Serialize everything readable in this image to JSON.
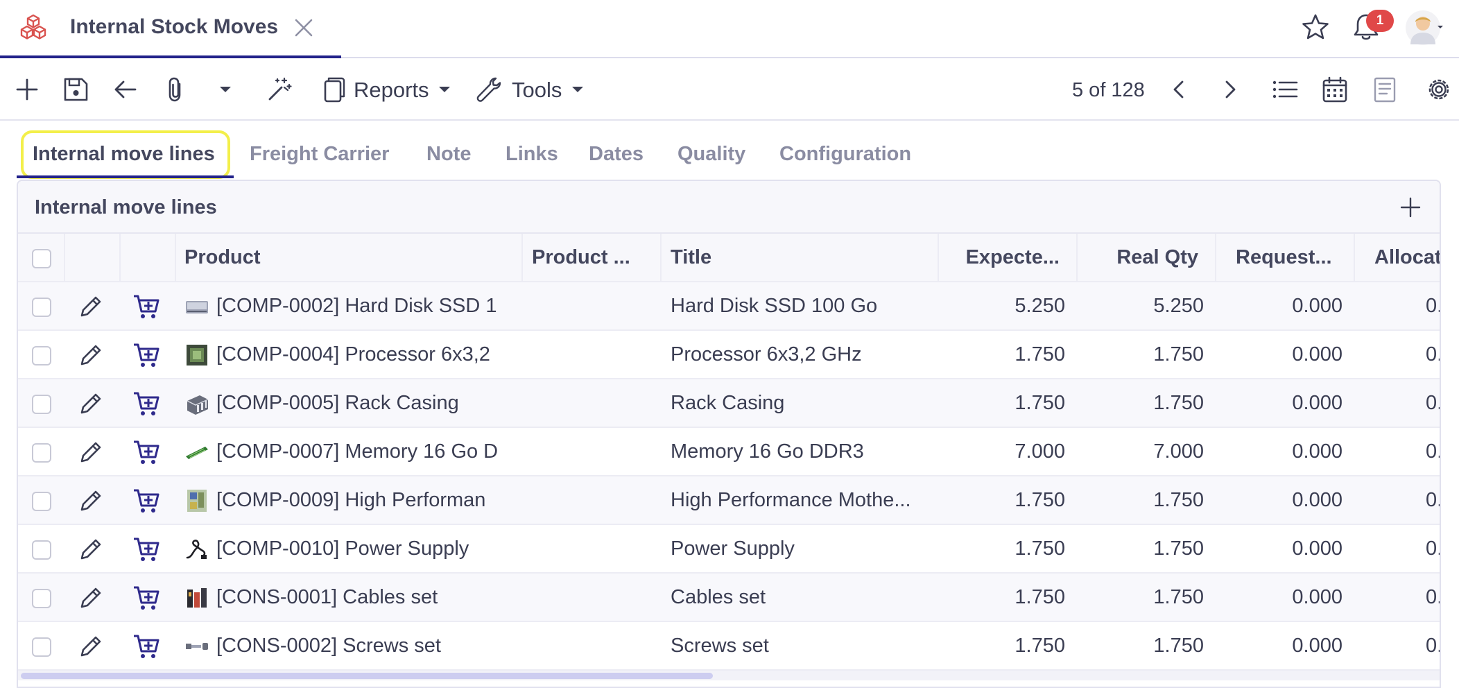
{
  "topbar": {
    "tab_title": "Internal Stock Moves",
    "notification_count": "1",
    "icons": [
      "app-logo-icon",
      "close-icon",
      "star-icon",
      "bell-icon",
      "avatar"
    ]
  },
  "toolbar": {
    "reports_label": "Reports",
    "tools_label": "Tools",
    "pager_text": "5 of 128",
    "icons": [
      "plus-icon",
      "save-icon",
      "back-arrow-icon",
      "paperclip-icon",
      "caret-down-icon",
      "magic-wand-icon",
      "copy-icon",
      "wrench-icon",
      "chevron-left-icon",
      "chevron-right-icon",
      "list-view-icon",
      "calendar-view-icon",
      "form-view-icon",
      "gear-icon"
    ]
  },
  "form_tabs": [
    {
      "label": "Internal move lines",
      "active": true
    },
    {
      "label": "Freight Carrier",
      "active": false
    },
    {
      "label": "Note",
      "active": false
    },
    {
      "label": "Links",
      "active": false
    },
    {
      "label": "Dates",
      "active": false
    },
    {
      "label": "Quality",
      "active": false
    },
    {
      "label": "Configuration",
      "active": false
    }
  ],
  "panel": {
    "title": "Internal move lines"
  },
  "table": {
    "columns": [
      "Product",
      "Product ...",
      "Title",
      "Expecte...",
      "Real Qty",
      "Request...",
      "Allocat"
    ],
    "rows": [
      {
        "product": "[COMP-0002] Hard Disk SSD 1",
        "title": "Hard Disk SSD 100 Go",
        "expected": "5.250",
        "real": "5.250",
        "requested": "0.000",
        "allocated": "0.",
        "image": "hard-disk-product-image"
      },
      {
        "product": "[COMP-0004] Processor 6x3,2",
        "title": "Processor 6x3,2 GHz",
        "expected": "1.750",
        "real": "1.750",
        "requested": "0.000",
        "allocated": "0.",
        "image": "processor-product-image"
      },
      {
        "product": "[COMP-0005] Rack Casing",
        "title": "Rack Casing",
        "expected": "1.750",
        "real": "1.750",
        "requested": "0.000",
        "allocated": "0.",
        "image": "rack-casing-product-image"
      },
      {
        "product": "[COMP-0007] Memory 16 Go D",
        "title": "Memory 16 Go DDR3",
        "expected": "7.000",
        "real": "7.000",
        "requested": "0.000",
        "allocated": "0.",
        "image": "memory-product-image"
      },
      {
        "product": "[COMP-0009] High Performan",
        "title": "High Performance Mothe...",
        "expected": "1.750",
        "real": "1.750",
        "requested": "0.000",
        "allocated": "0.",
        "image": "motherboard-product-image"
      },
      {
        "product": "[COMP-0010] Power Supply",
        "title": "Power Supply",
        "expected": "1.750",
        "real": "1.750",
        "requested": "0.000",
        "allocated": "0.",
        "image": "power-supply-product-image"
      },
      {
        "product": "[CONS-0001] Cables set",
        "title": "Cables set",
        "expected": "1.750",
        "real": "1.750",
        "requested": "0.000",
        "allocated": "0.",
        "image": "cables-product-image"
      },
      {
        "product": "[CONS-0002] Screws set",
        "title": "Screws set",
        "expected": "1.750",
        "real": "1.750",
        "requested": "0.000",
        "allocated": "0.",
        "image": "screws-product-image"
      }
    ]
  },
  "colors": {
    "accent": "#22228a",
    "highlight": "#f3ef4a",
    "badge": "#e04848",
    "cart": "#2f2a8c",
    "text": "#3a3d52",
    "muted_tab": "#8a8ca2"
  }
}
